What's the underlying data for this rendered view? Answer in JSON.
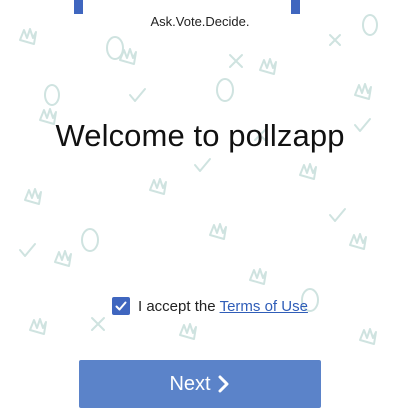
{
  "app": {
    "tagline": "Ask.Vote.Decide.",
    "welcome_title": "Welcome to pollzapp"
  },
  "terms": {
    "checked": true,
    "accept_text": "I accept the",
    "link_text": "Terms of Use"
  },
  "next_button": {
    "label": "Next",
    "icon": "chevron-right-icon"
  },
  "colors": {
    "accent": "#3f66bf",
    "button": "#5b83c9",
    "link": "#2f5db8",
    "pattern": "#cfe3e0"
  }
}
